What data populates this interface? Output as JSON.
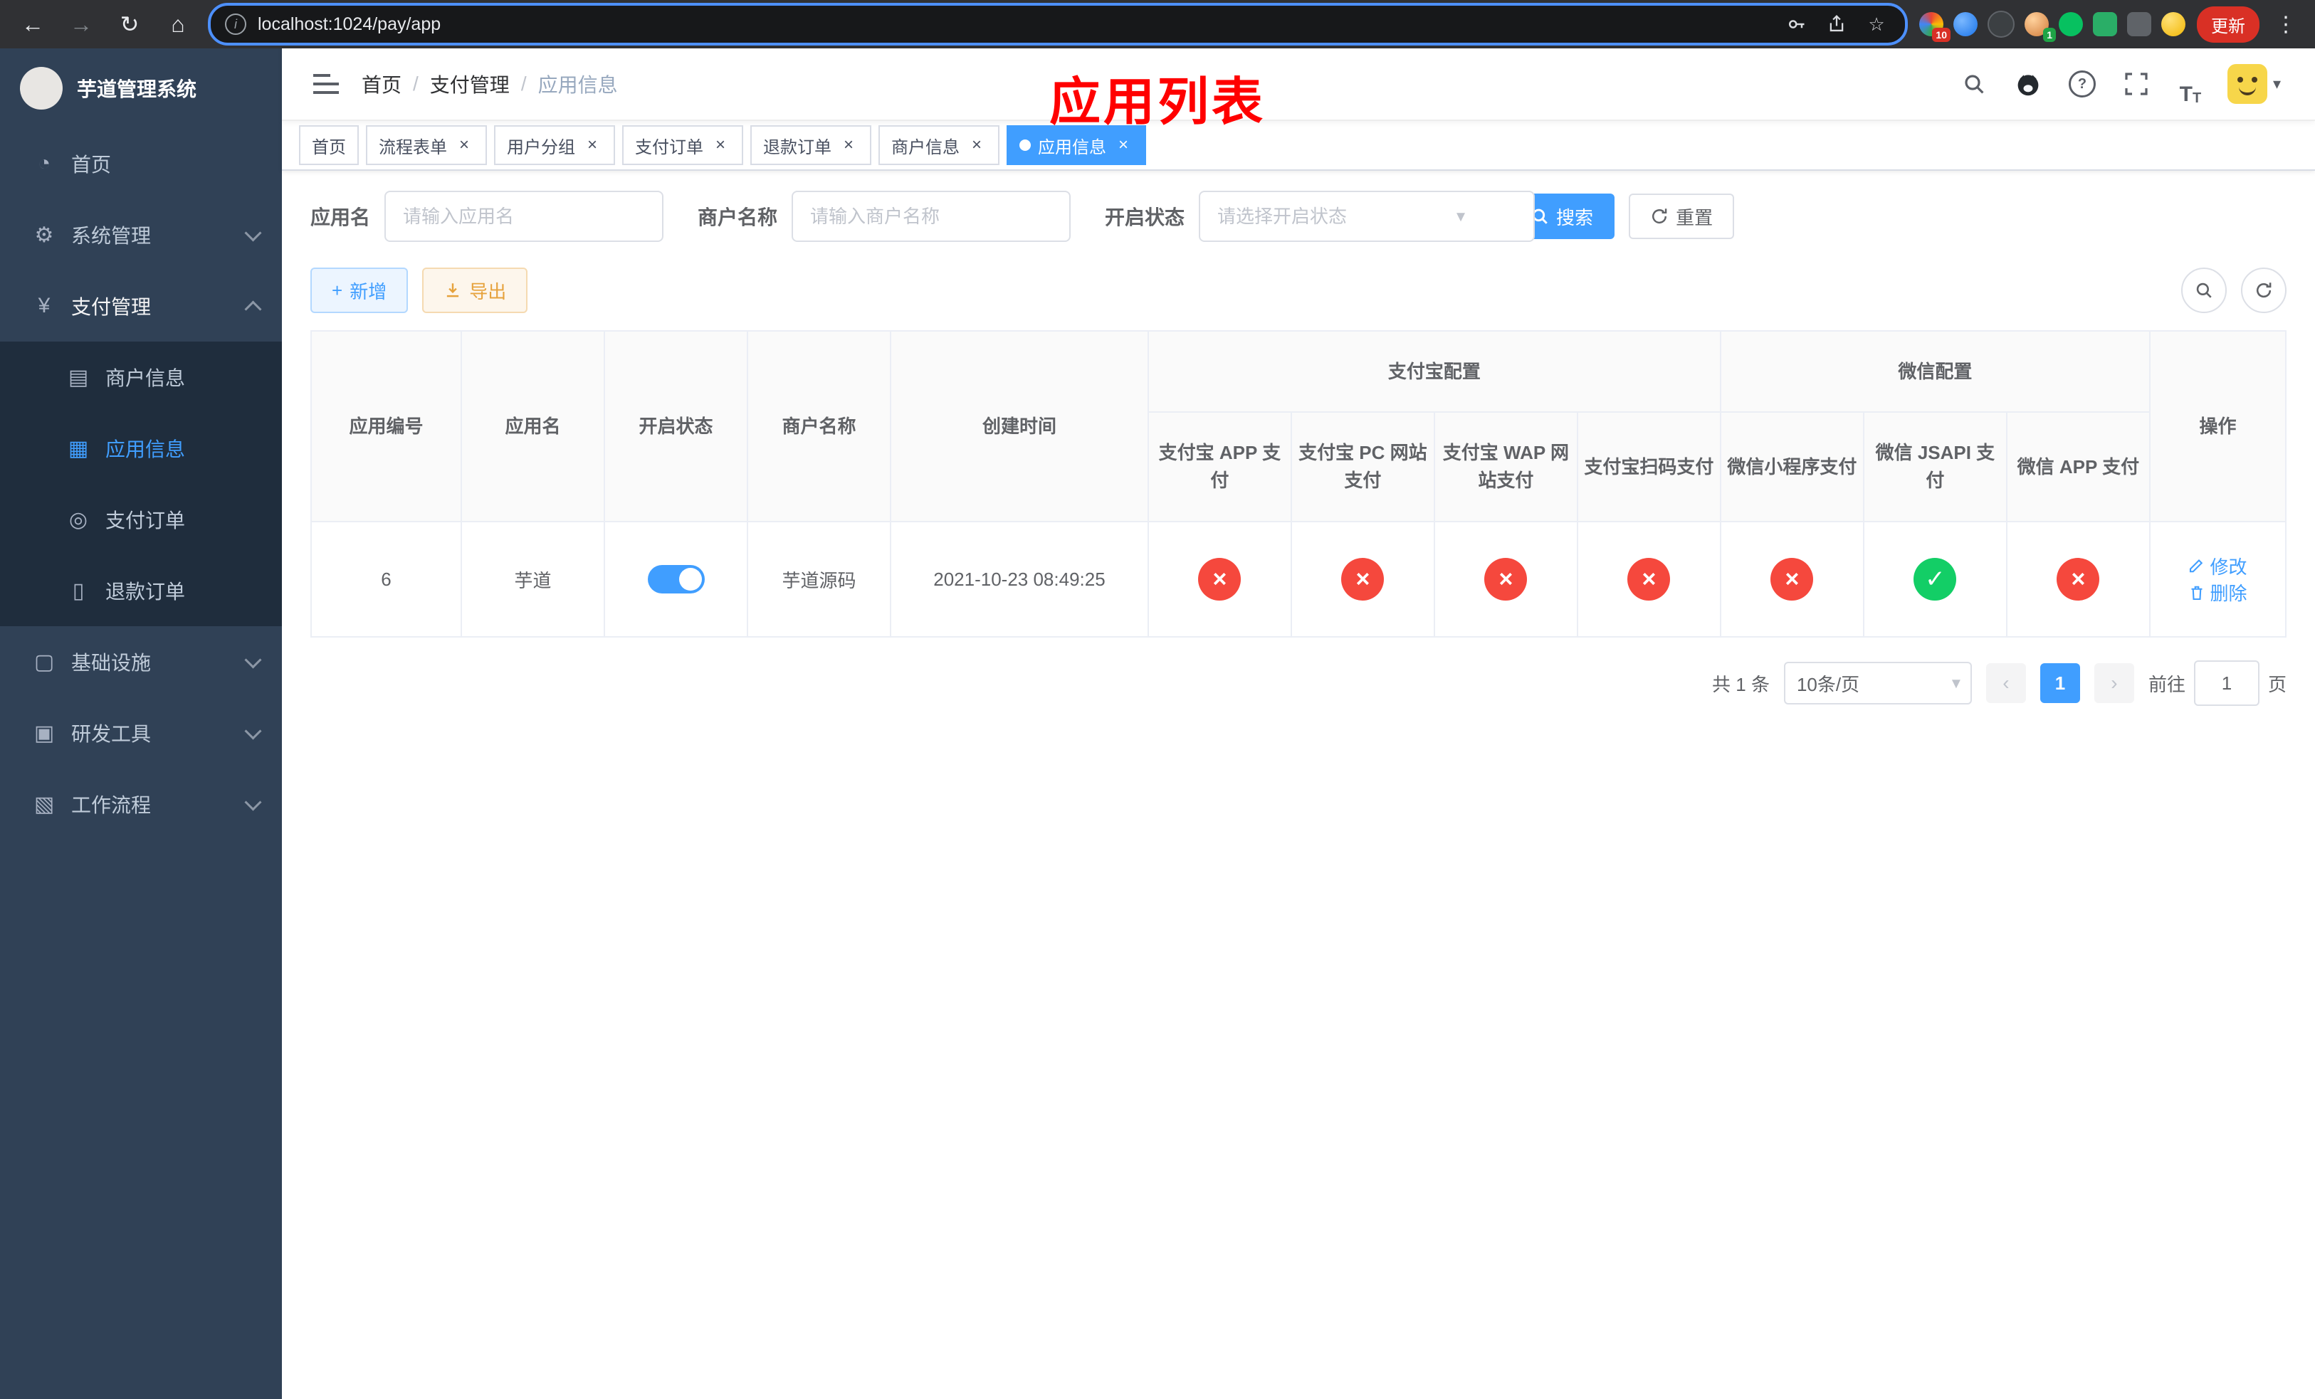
{
  "theme": {
    "primary": "#409eff",
    "success": "#13ce66",
    "danger": "#f5483d",
    "warning": "#e6a23c",
    "sidebar-bg": "#304156",
    "submenu-bg": "#1f2d3d",
    "annotation": "#ff0000"
  },
  "icons": {
    "back": "←",
    "forward": "→",
    "reload": "↻",
    "home": "⌂",
    "key": "⚿",
    "star": "☆",
    "dots": "⋮",
    "info": "i",
    "dashboard": "◔",
    "gear": "⚙",
    "yen": "¥",
    "card": "▤",
    "grid": "▦",
    "order": "◎",
    "refund": "▯",
    "infra": "▢",
    "tools": "▣",
    "workflow": "▧",
    "caret": "▾",
    "close": "×",
    "plus": "+",
    "question": "?",
    "fontsize_big": "T",
    "fontsize_small": "T",
    "check": "✓",
    "cross": "×",
    "prev": "‹",
    "next": "›",
    "slash": "/"
  },
  "browser": {
    "url": "localhost:1024/pay/app",
    "update_label": "更新",
    "ext_badge_tabs": "10",
    "ext_badge_avatar": "1"
  },
  "sidebar": {
    "title": "芋道管理系统",
    "home": "首页",
    "system": "系统管理",
    "payment": "支付管理",
    "merchant_info": "商户信息",
    "app_info": "应用信息",
    "pay_order": "支付订单",
    "refund_order": "退款订单",
    "infra": "基础设施",
    "dev_tools": "研发工具",
    "workflow": "工作流程"
  },
  "header": {
    "breadcrumb_home": "首页",
    "breadcrumb_section": "支付管理",
    "breadcrumb_current": "应用信息",
    "breadcrumb_sep": "/",
    "annotation": "应用列表"
  },
  "tabs": [
    {
      "label": "首页",
      "closable": false,
      "active": false
    },
    {
      "label": "流程表单",
      "closable": true,
      "active": false
    },
    {
      "label": "用户分组",
      "closable": true,
      "active": false
    },
    {
      "label": "支付订单",
      "closable": true,
      "active": false
    },
    {
      "label": "退款订单",
      "closable": true,
      "active": false
    },
    {
      "label": "商户信息",
      "closable": true,
      "active": false
    },
    {
      "label": "应用信息",
      "closable": true,
      "active": true
    }
  ],
  "filters": {
    "app_name_label": "应用名",
    "app_name_placeholder": "请输入应用名",
    "merchant_label": "商户名称",
    "merchant_placeholder": "请输入商户名称",
    "status_label": "开启状态",
    "status_placeholder": "请选择开启状态",
    "search_label": "搜索",
    "reset_label": "重置"
  },
  "toolbar": {
    "add_label": "新增",
    "export_label": "导出"
  },
  "table": {
    "headers": {
      "app_id": "应用编号",
      "app_name": "应用名",
      "status": "开启状态",
      "merchant": "商户名称",
      "created": "创建时间",
      "alipay_group": "支付宝配置",
      "wechat_group": "微信配置",
      "alipay_app": "支付宝 APP 支付",
      "alipay_pc": "支付宝 PC 网站支付",
      "alipay_wap": "支付宝 WAP 网站支付",
      "alipay_qr": "支付宝扫码支付",
      "wx_mini": "微信小程序支付",
      "wx_jsapi": "微信 JSAPI 支付",
      "wx_app": "微信 APP 支付",
      "actions": "操作"
    },
    "row": {
      "id": "6",
      "name": "芋道",
      "enabled": true,
      "merchant": "芋道源码",
      "created": "2021-10-23 08:49:25",
      "statuses": [
        false,
        false,
        false,
        false,
        false,
        true,
        false
      ],
      "edit_label": "修改",
      "delete_label": "删除"
    }
  },
  "pagination": {
    "total": "共 1 条",
    "page_size": "10条/页",
    "page": "1",
    "goto_label": "前往",
    "goto_value": "1",
    "page_unit": "页"
  }
}
